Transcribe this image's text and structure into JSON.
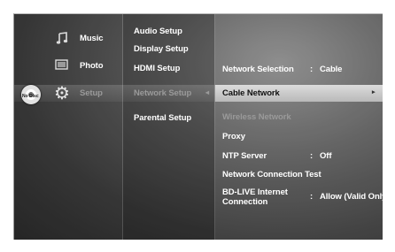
{
  "left_menu": {
    "items": [
      {
        "label": "Music",
        "icon": "music-icon"
      },
      {
        "label": "Photo",
        "icon": "photo-icon"
      },
      {
        "label": "Setup",
        "icon": "gear-icon"
      }
    ],
    "disc_status": "No Disc"
  },
  "setup_menu": {
    "items": [
      "Audio Setup",
      "Display Setup",
      "HDMI Setup",
      "Network Setup",
      "Parental Setup"
    ],
    "selected_arrow": "◂"
  },
  "network_menu": {
    "items": [
      {
        "label": "Network Selection",
        "value": "Cable"
      },
      {
        "label": "Cable Network",
        "arrow": "▸"
      },
      {
        "label": "Wireless Network"
      },
      {
        "label": "Proxy"
      },
      {
        "label": "NTP Server",
        "value": "Off"
      },
      {
        "label": "Network Connection Test"
      },
      {
        "label": "BD-LIVE Internet Connection",
        "value": "Allow (Valid Only)"
      }
    ],
    "separator": ":"
  }
}
